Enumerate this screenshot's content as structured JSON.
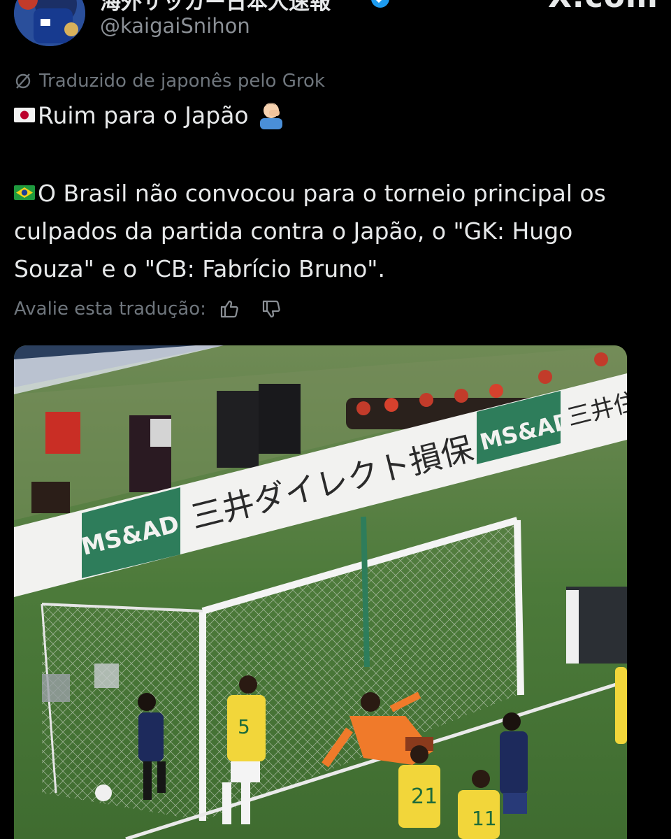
{
  "header": {
    "display_name": "海外サッカー日本人速報",
    "handle": "@kaigaiSnihon",
    "brand": "X.com",
    "avatar_icon": "player-avatar-icon",
    "verified_icon": "verified-badge-icon"
  },
  "translation": {
    "notice": "Traduzido de japonês pelo Grok",
    "icon": "grok-icon"
  },
  "post": {
    "line1": "Ruim para o Japão",
    "line1_flag": "japan-flag-icon",
    "line1_emoji": "facepalm-emoji-icon",
    "paragraph": "O Brasil não convocou para o torneio principal os culpados da partida contra o Japão, o \"GK: Hugo Souza\" e o \"CB: Fabrício Bruno\".",
    "paragraph_flag": "brazil-flag-icon"
  },
  "rating": {
    "label": "Avalie esta tradução:",
    "up_icon": "thumbs-up-icon",
    "down_icon": "thumbs-down-icon"
  },
  "media": {
    "board_text_1": "MS&AD",
    "board_text_2": "三井ダイレクト損保",
    "board_text_3": "MS&AD",
    "board_text_4": "三井住",
    "shirt_5": "5",
    "shirt_21": "21",
    "shirt_11": "11"
  },
  "colors": {
    "background": "#000000",
    "text": "#e7e9ea",
    "muted": "#6f767d",
    "verified": "#1d9bf0",
    "board_green": "#2e7d5b"
  }
}
